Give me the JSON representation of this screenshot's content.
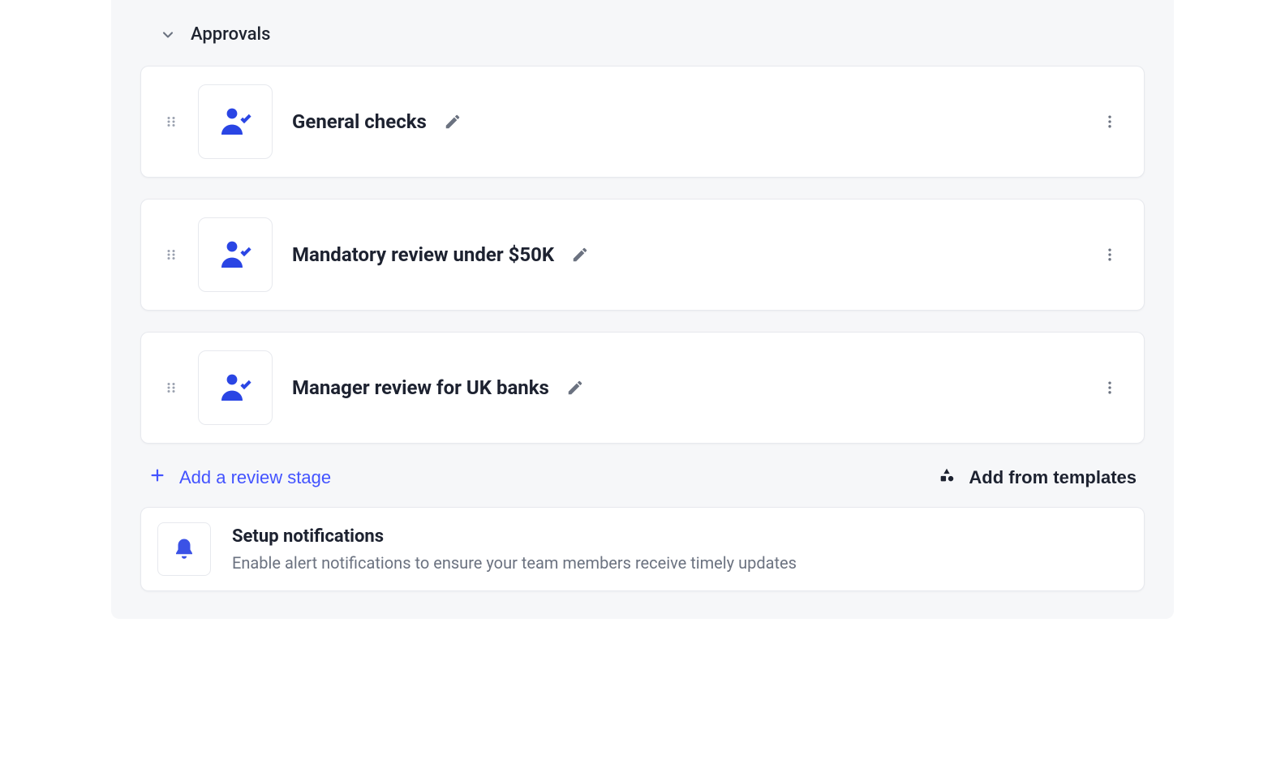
{
  "section": {
    "title": "Approvals"
  },
  "stages": [
    {
      "title": "General checks"
    },
    {
      "title": "Mandatory review under $50K"
    },
    {
      "title": "Manager review for UK banks"
    }
  ],
  "actions": {
    "add_stage": "Add a review stage",
    "add_from_templates": "Add from templates"
  },
  "notifications": {
    "title": "Setup notifications",
    "description": "Enable alert notifications to ensure your team members receive timely updates"
  },
  "colors": {
    "accent": "#4353ff",
    "icon_blue": "#2a45e4"
  }
}
